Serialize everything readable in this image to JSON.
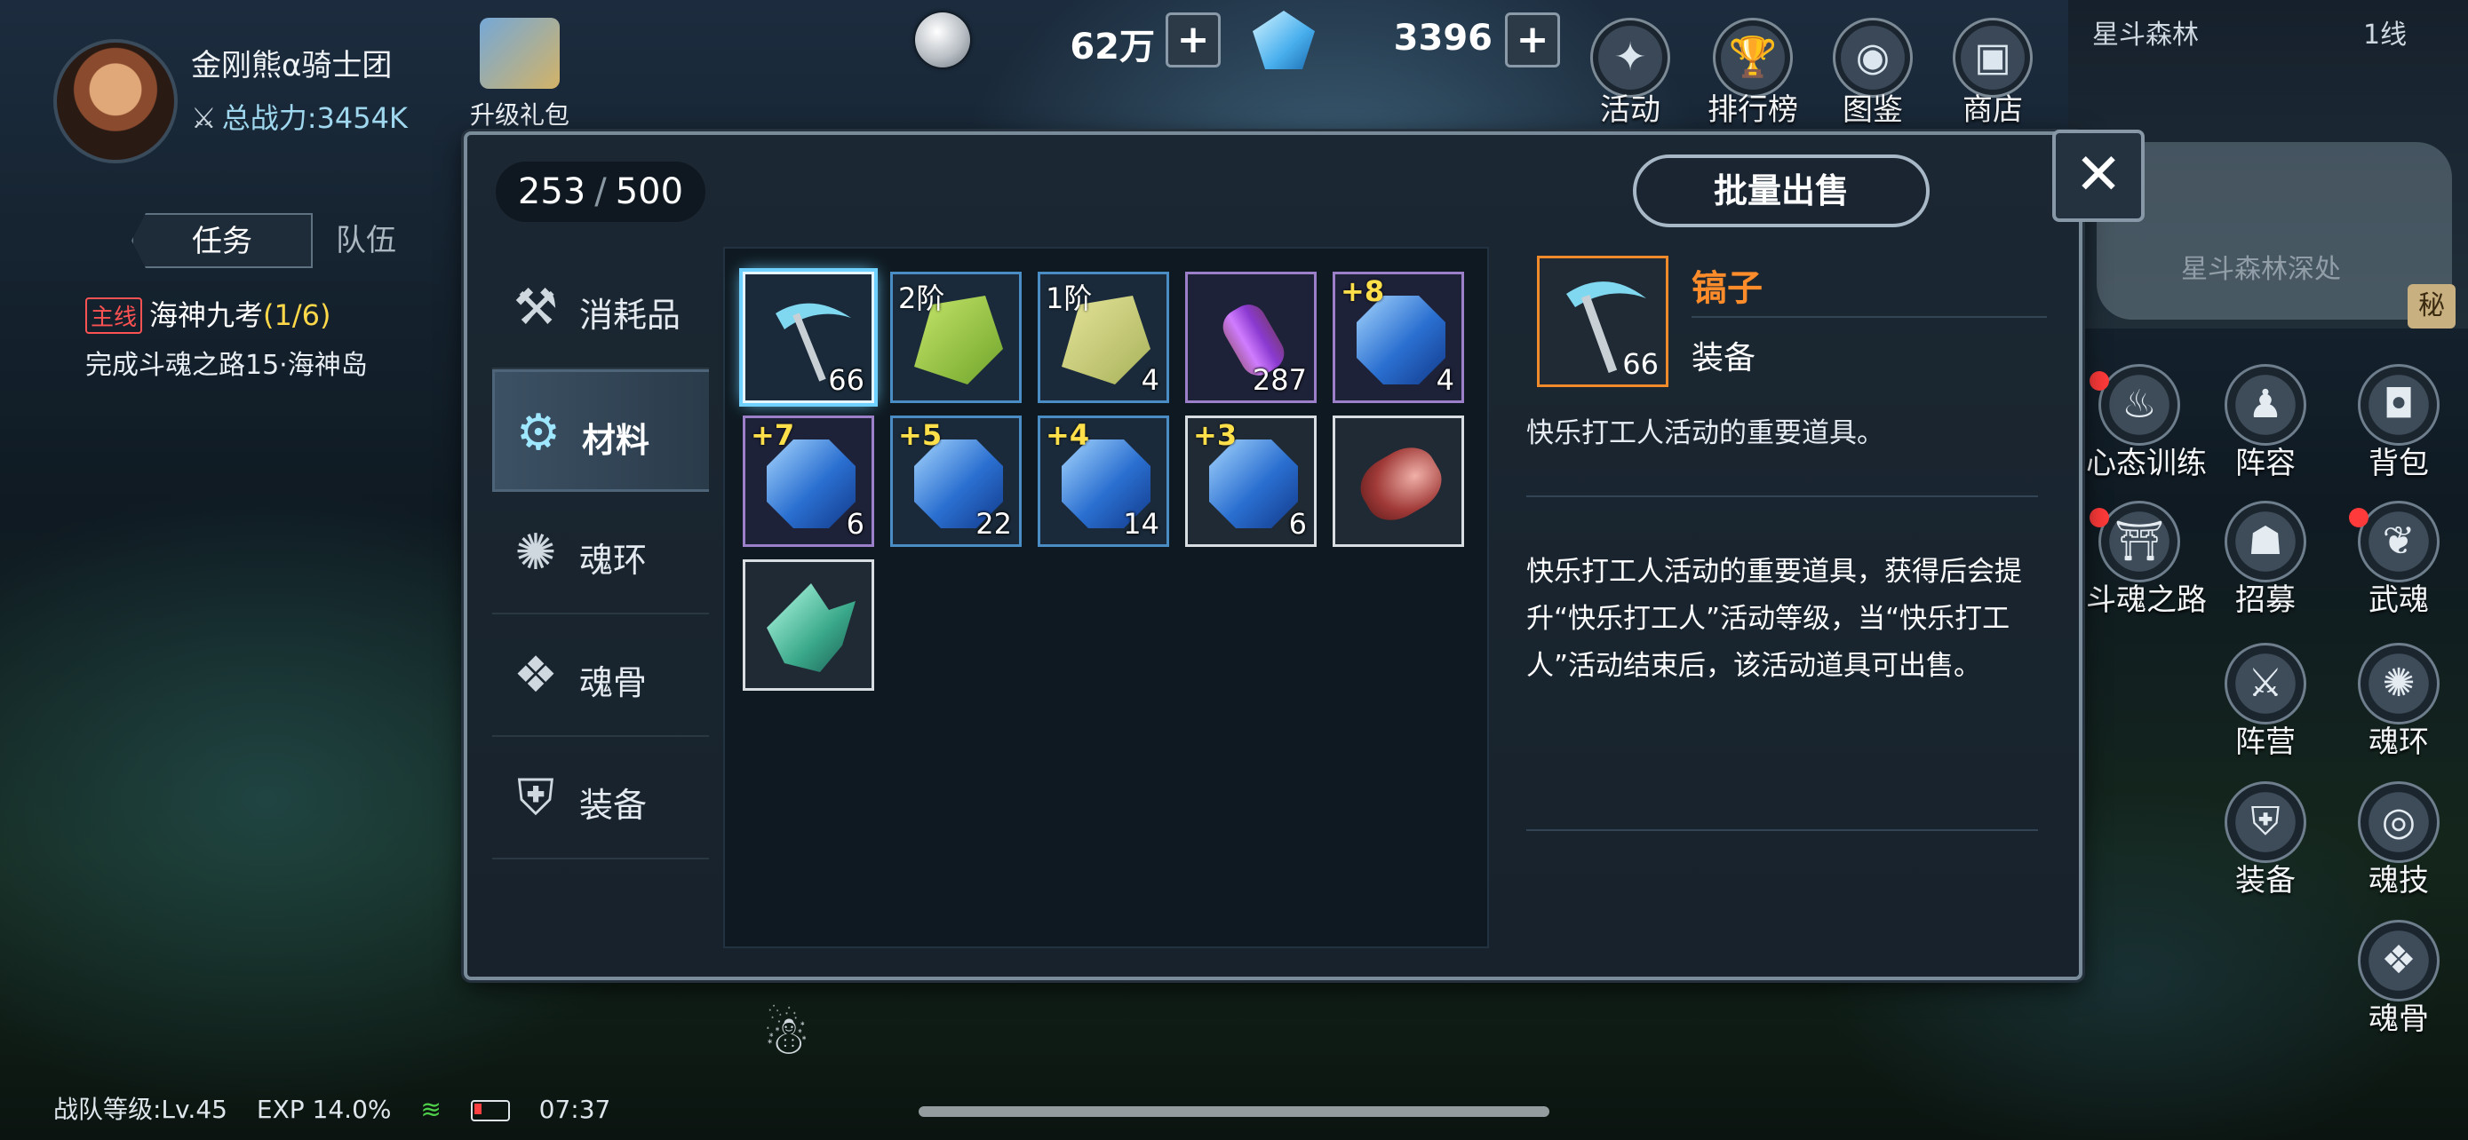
{
  "profile": {
    "team_name": "金刚熊α骑士团",
    "power_label": "总战力:",
    "power_value": "3454K"
  },
  "gift": {
    "label": "升级礼包"
  },
  "currency": {
    "coins": "62万",
    "gems": "3396",
    "plus": "+"
  },
  "top_menu": [
    {
      "label": "活动",
      "icon": "activity-icon",
      "glyph": "✦"
    },
    {
      "label": "排行榜",
      "icon": "trophy-icon",
      "glyph": "🏆"
    },
    {
      "label": "图鉴",
      "icon": "codex-icon",
      "glyph": "◉"
    },
    {
      "label": "商店",
      "icon": "shop-icon",
      "glyph": "▣"
    }
  ],
  "map": {
    "name": "星斗森林",
    "line": "1线",
    "area": "星斗森林深处",
    "secret": "秘"
  },
  "left_tabs": {
    "quest": "任务",
    "team": "队伍"
  },
  "quest": {
    "tag": "主线",
    "title": "海神九考",
    "progress": "(1/6)",
    "desc": "完成斗魂之路15·海神岛"
  },
  "bag": {
    "count_used": "253",
    "count_sep": "/",
    "count_max": "500",
    "sell_button": "批量出售",
    "close": "✕",
    "categories": [
      {
        "label": "消耗品",
        "icon": "consumable-icon",
        "glyph": "⚒"
      },
      {
        "label": "材料",
        "icon": "material-anvil-icon",
        "glyph": "⚙",
        "active": true
      },
      {
        "label": "魂环",
        "icon": "soul-ring-icon",
        "glyph": "✺"
      },
      {
        "label": "魂骨",
        "icon": "soul-bone-icon",
        "glyph": "❖"
      },
      {
        "label": "装备",
        "icon": "equipment-icon",
        "glyph": "⛨"
      }
    ],
    "items": [
      {
        "name": "pickaxe",
        "qty": "66",
        "tier": "",
        "plus": "",
        "rarity": "blue",
        "selected": true,
        "art": "pick"
      },
      {
        "name": "leaf-material",
        "qty": "",
        "tier": "2阶",
        "plus": "",
        "rarity": "blue",
        "art": "leaf"
      },
      {
        "name": "leaf-material",
        "qty": "4",
        "tier": "1阶",
        "plus": "",
        "rarity": "blue",
        "art": "leaf2"
      },
      {
        "name": "vial",
        "qty": "287",
        "tier": "",
        "plus": "",
        "rarity": "purple",
        "art": "vial"
      },
      {
        "name": "gem",
        "qty": "4",
        "tier": "",
        "plus": "+8",
        "rarity": "purple",
        "art": "gem"
      },
      {
        "name": "gem",
        "qty": "6",
        "tier": "",
        "plus": "+7",
        "rarity": "purple",
        "art": "gem"
      },
      {
        "name": "gem",
        "qty": "22",
        "tier": "",
        "plus": "+5",
        "rarity": "blue",
        "art": "gem"
      },
      {
        "name": "gem",
        "qty": "14",
        "tier": "",
        "plus": "+4",
        "rarity": "blue",
        "art": "gem"
      },
      {
        "name": "gem",
        "qty": "6",
        "tier": "",
        "plus": "+3",
        "rarity": "white",
        "art": "gem"
      },
      {
        "name": "log",
        "qty": "",
        "tier": "",
        "plus": "",
        "rarity": "white",
        "art": "log"
      },
      {
        "name": "crystal",
        "qty": "",
        "tier": "",
        "plus": "",
        "rarity": "white",
        "art": "crystal"
      }
    ],
    "detail": {
      "name": "镐子",
      "qty": "66",
      "type": "装备",
      "short_desc": "快乐打工人活动的重要道具。",
      "long_desc": "快乐打工人活动的重要道具，获得后会提升“快乐打工人”活动等级，当“快乐打工人”活动结束后，该活动道具可出售。"
    }
  },
  "side_icons": [
    {
      "label": "心态训练",
      "icon": "meditation-icon",
      "glyph": "♨",
      "dot": true
    },
    {
      "label": "阵容",
      "icon": "lineup-icon",
      "glyph": "♟"
    },
    {
      "label": "背包",
      "icon": "backpack-icon",
      "glyph": "◘"
    },
    {
      "label": "斗魂之路",
      "icon": "soul-road-icon",
      "glyph": "⛩",
      "dot": true
    },
    {
      "label": "招募",
      "icon": "recruit-icon",
      "glyph": "☗"
    },
    {
      "label": "武魂",
      "icon": "martial-soul-icon",
      "glyph": "❦",
      "dot": true
    },
    {
      "label": "阵营",
      "icon": "camp-icon",
      "glyph": "⚔"
    },
    {
      "label": "魂环",
      "icon": "soul-ring-icon",
      "glyph": "✺"
    },
    {
      "label": "装备",
      "icon": "equipment-icon",
      "glyph": "⛨"
    },
    {
      "label": "魂技",
      "icon": "soul-skill-icon",
      "glyph": "◎"
    },
    {
      "label": "魂骨",
      "icon": "soul-bone-icon",
      "glyph": "❖"
    }
  ],
  "status": {
    "level": "战队等级:Lv.45",
    "exp": "EXP 14.0%",
    "time": "07:37"
  }
}
